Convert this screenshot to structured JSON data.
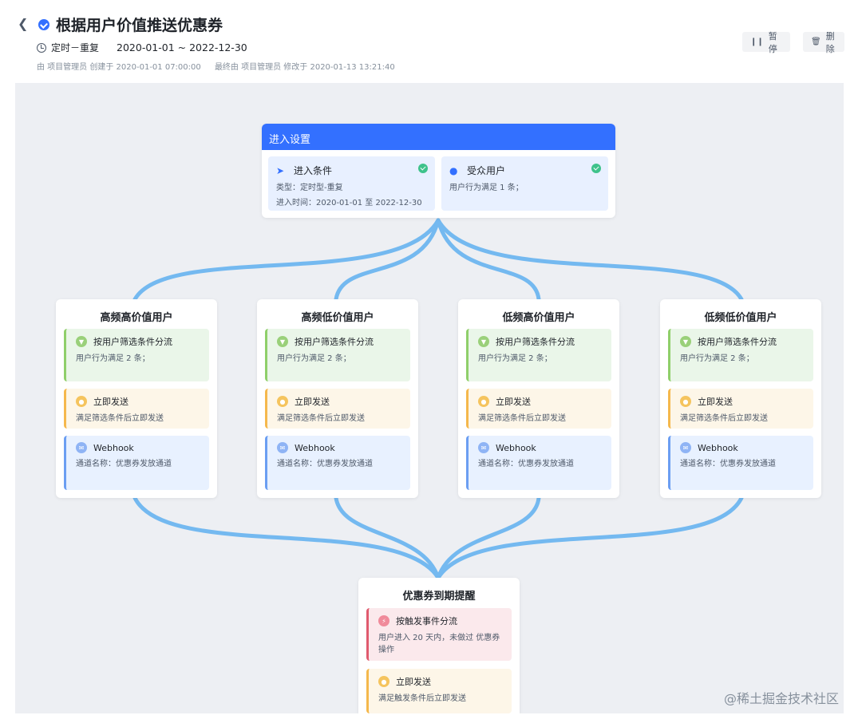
{
  "header": {
    "back_icon": "chevron-left-icon",
    "title": "根据用户价值推送优惠券",
    "schedule_type": "定时－重复",
    "date_range": "2020-01-01 ~ 2022-12-30",
    "created": "由 项目管理员 创建于 2020-01-01 07:00:00",
    "modified": "最终由 项目管理员 修改于 2020-01-13 13:21:40",
    "pause_label": "暂停",
    "delete_label": "删除"
  },
  "entry": {
    "title": "进入设置",
    "condition": {
      "title": "进入条件",
      "icon": "paper-plane-icon",
      "line1": "类型：定时型-重复",
      "line2": "进入时间：2020-01-01 至 2022-12-30"
    },
    "audience": {
      "title": "受众用户",
      "icon": "user-icon",
      "line1": "用户行为满足 1 条；"
    }
  },
  "branches": [
    {
      "title": "高频高价值用户",
      "filter_title": "按用户筛选条件分流",
      "filter_desc": "用户行为满足 2 条；",
      "send_title": "立即发送",
      "send_desc": "满足筛选条件后立即发送",
      "webhook_title": "Webhook",
      "webhook_desc": "通道名称：优惠券发放通道"
    },
    {
      "title": "高频低价值用户",
      "filter_title": "按用户筛选条件分流",
      "filter_desc": "用户行为满足 2 条；",
      "send_title": "立即发送",
      "send_desc": "满足筛选条件后立即发送",
      "webhook_title": "Webhook",
      "webhook_desc": "通道名称：优惠券发放通道"
    },
    {
      "title": "低频高价值用户",
      "filter_title": "按用户筛选条件分流",
      "filter_desc": "用户行为满足 2 条；",
      "send_title": "立即发送",
      "send_desc": "满足筛选条件后立即发送",
      "webhook_title": "Webhook",
      "webhook_desc": "通道名称：优惠券发放通道"
    },
    {
      "title": "低频低价值用户",
      "filter_title": "按用户筛选条件分流",
      "filter_desc": "用户行为满足 2 条；",
      "send_title": "立即发送",
      "send_desc": "满足筛选条件后立即发送",
      "webhook_title": "Webhook",
      "webhook_desc": "通道名称：优惠券发放通道"
    }
  ],
  "final": {
    "title": "优惠券到期提醒",
    "trigger_title": "按触发事件分流",
    "trigger_desc": "用户进入 20 天内，未做过 优惠券操作",
    "send_title": "立即发送",
    "send_desc": "满足触发条件后立即发送"
  },
  "watermark": "@稀土掘金技术社区",
  "colors": {
    "accent": "#3370ff",
    "connector": "#74b9f0",
    "canvas_bg": "#edeff3",
    "success": "#3ec28b"
  }
}
